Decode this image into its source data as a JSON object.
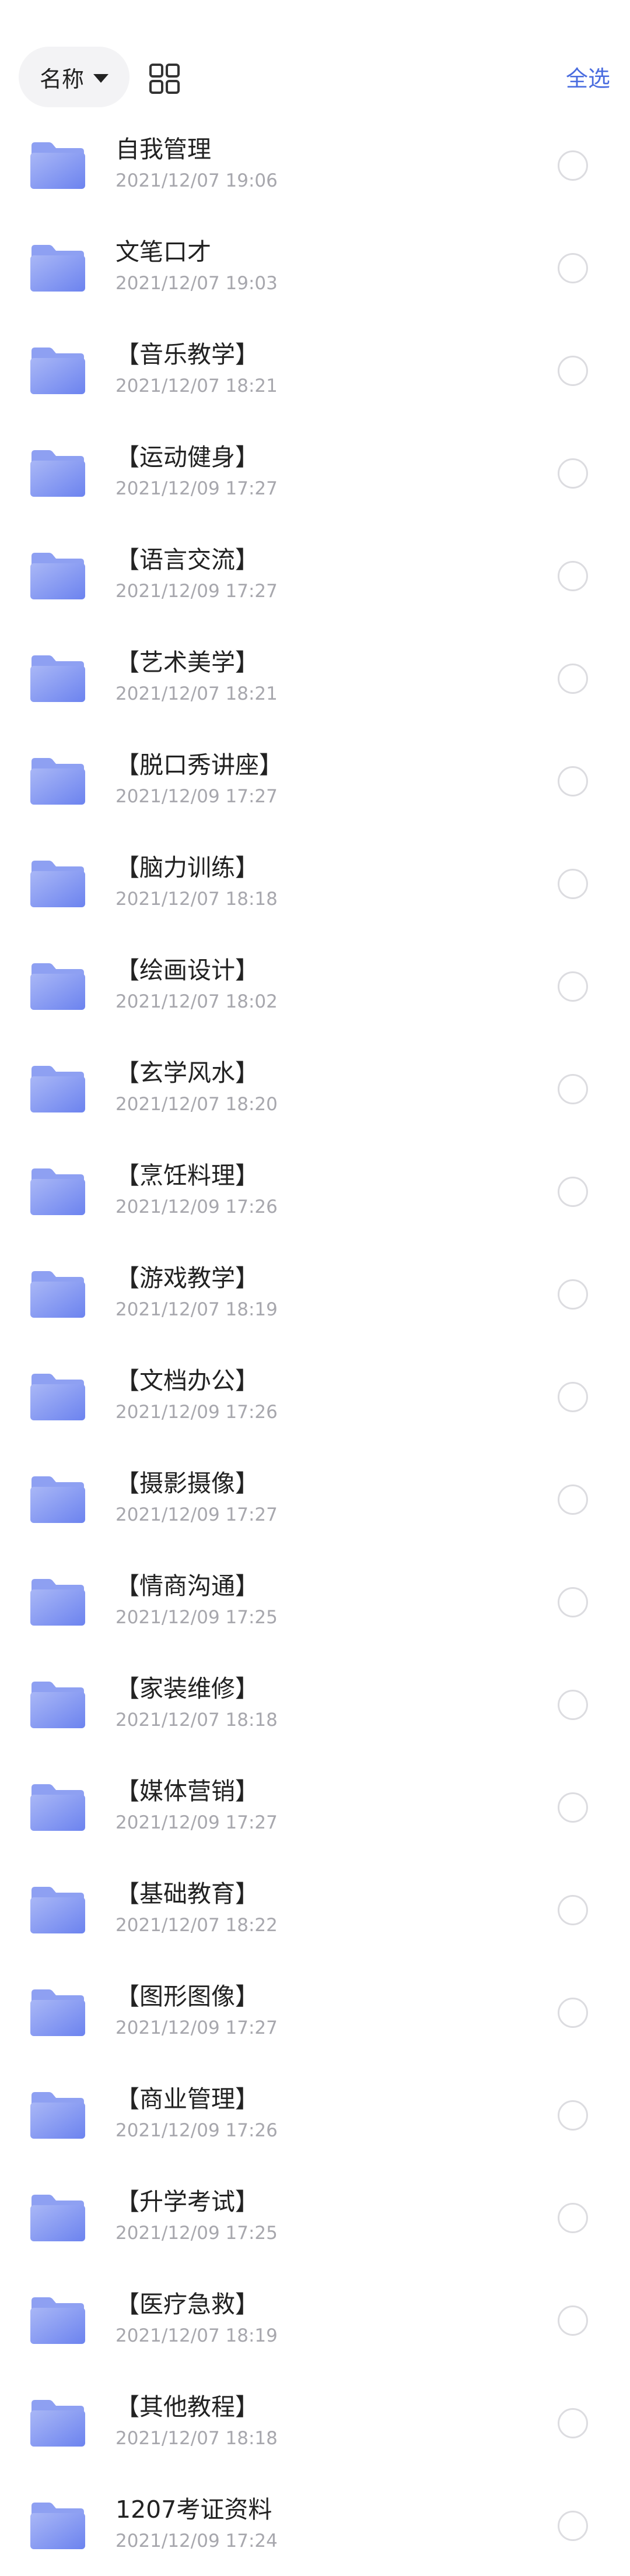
{
  "toolbar": {
    "sort_label": "名称",
    "sort_icon": "caret-down-icon",
    "view_icon": "grid-view-icon",
    "select_all_label": "全选"
  },
  "colors": {
    "accent": "#4a6cdf",
    "folder_light": "#a9b7f6",
    "folder_dark": "#6c83ef",
    "folder_tab": "#8ea0f2",
    "date_text": "#a7a7ad",
    "checkbox_border": "#dcdce0"
  },
  "files": [
    {
      "name": "自我管理",
      "date": "2021/12/07 19:06"
    },
    {
      "name": "文笔口才",
      "date": "2021/12/07 19:03"
    },
    {
      "name": "【音乐教学】",
      "date": "2021/12/07 18:21"
    },
    {
      "name": "【运动健身】",
      "date": "2021/12/09 17:27"
    },
    {
      "name": "【语言交流】",
      "date": "2021/12/09 17:27"
    },
    {
      "name": "【艺术美学】",
      "date": "2021/12/07 18:21"
    },
    {
      "name": "【脱口秀讲座】",
      "date": "2021/12/09 17:27"
    },
    {
      "name": "【脑力训练】",
      "date": "2021/12/07 18:18"
    },
    {
      "name": "【绘画设计】",
      "date": "2021/12/07 18:02"
    },
    {
      "name": "【玄学风水】",
      "date": "2021/12/07 18:20"
    },
    {
      "name": "【烹饪料理】",
      "date": "2021/12/09 17:26"
    },
    {
      "name": "【游戏教学】",
      "date": "2021/12/07 18:19"
    },
    {
      "name": "【文档办公】",
      "date": "2021/12/09 17:26"
    },
    {
      "name": "【摄影摄像】",
      "date": "2021/12/09 17:27"
    },
    {
      "name": "【情商沟通】",
      "date": "2021/12/09 17:25"
    },
    {
      "name": "【家装维修】",
      "date": "2021/12/07 18:18"
    },
    {
      "name": "【媒体营销】",
      "date": "2021/12/09 17:27"
    },
    {
      "name": "【基础教育】",
      "date": "2021/12/07 18:22"
    },
    {
      "name": "【图形图像】",
      "date": "2021/12/09 17:27"
    },
    {
      "name": "【商业管理】",
      "date": "2021/12/09 17:26"
    },
    {
      "name": "【升学考试】",
      "date": "2021/12/09 17:25"
    },
    {
      "name": "【医疗急救】",
      "date": "2021/12/07 18:19"
    },
    {
      "name": "【其他教程】",
      "date": "2021/12/07 18:18"
    },
    {
      "name": "1207考证资料",
      "date": "2021/12/09 17:24"
    }
  ]
}
